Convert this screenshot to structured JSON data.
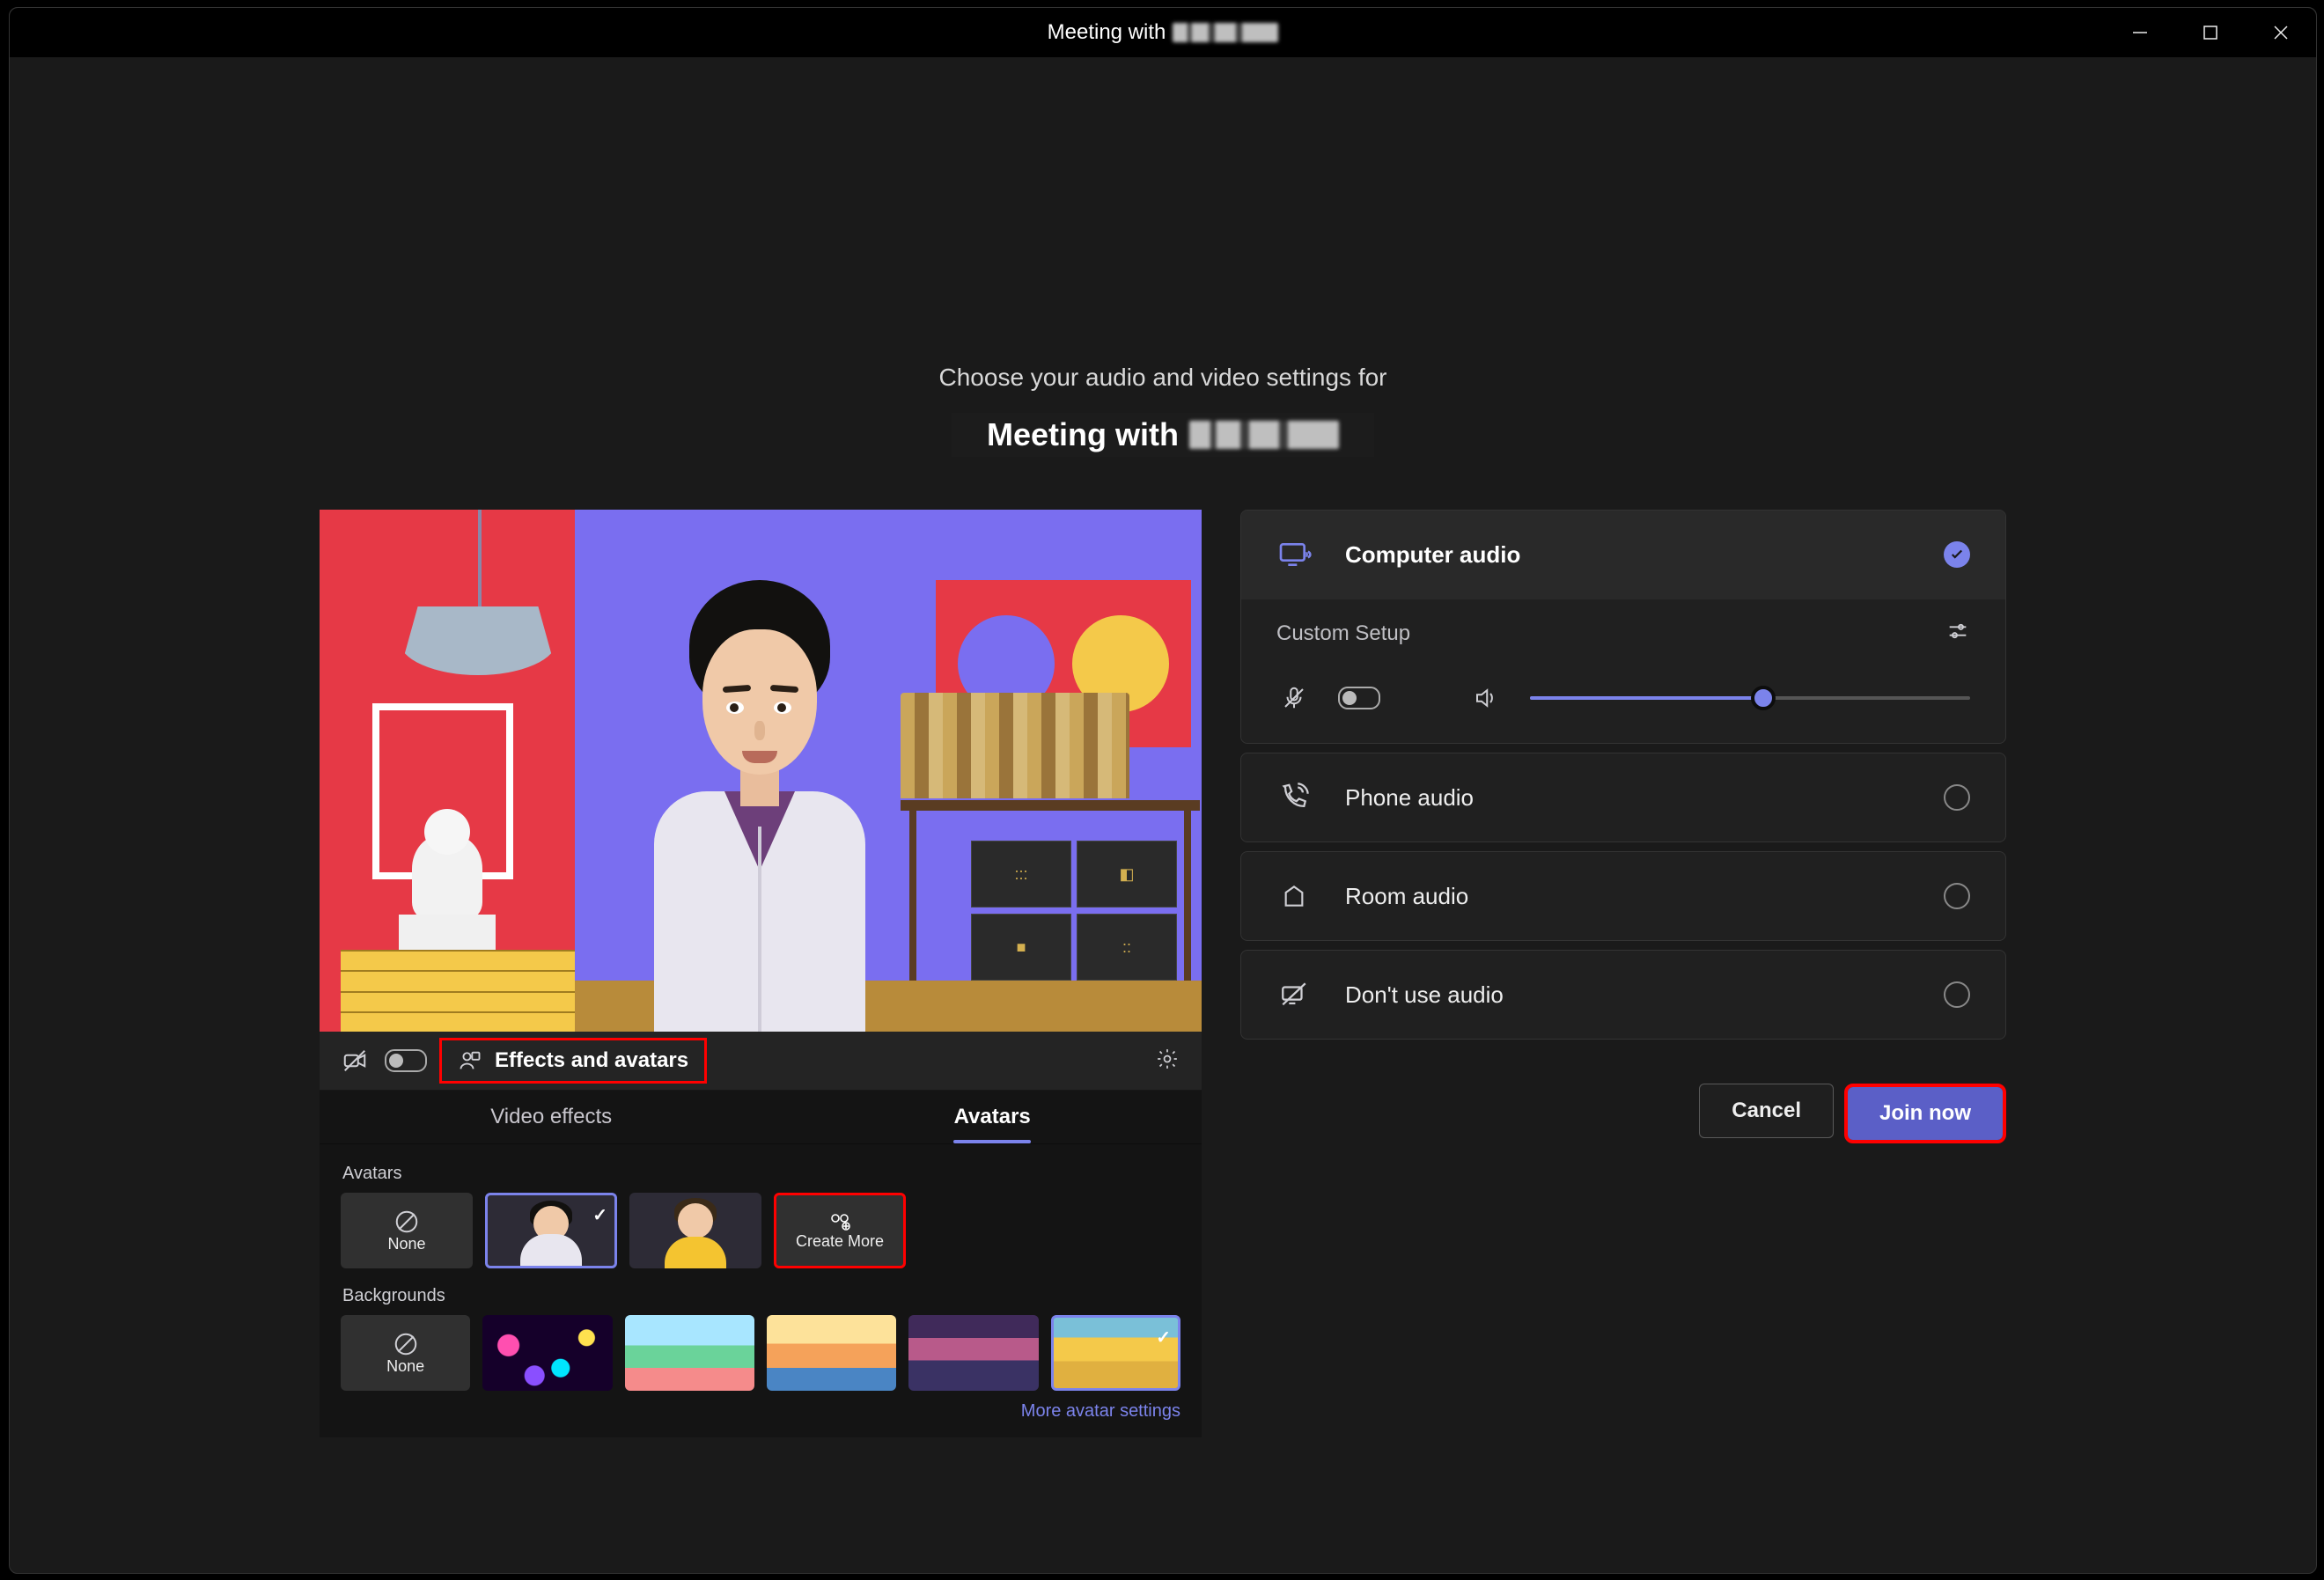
{
  "window": {
    "title_prefix": "Meeting with",
    "title_participant": "█████"
  },
  "header": {
    "prompt": "Choose your audio and video settings for",
    "meeting_prefix": "Meeting with",
    "meeting_participant": "█████"
  },
  "preview": {
    "camera_toggle_state": "off",
    "effects_button_label": "Effects and avatars",
    "settings_icon": "gear"
  },
  "tabs": {
    "video_effects": "Video effects",
    "avatars": "Avatars",
    "active": "avatars"
  },
  "avatars": {
    "section_label": "Avatars",
    "none_label": "None",
    "create_more_label": "Create More",
    "selected_index": 1
  },
  "backgrounds": {
    "section_label": "Backgrounds",
    "none_label": "None",
    "selected_index": 5,
    "more_settings": "More avatar settings"
  },
  "audio": {
    "computer_audio": "Computer audio",
    "custom_setup": "Custom Setup",
    "mic_state": "muted",
    "mic_toggle_state": "off",
    "volume_percent": 53,
    "phone_audio": "Phone audio",
    "room_audio": "Room audio",
    "no_audio": "Don't use audio",
    "selected": "computer_audio"
  },
  "actions": {
    "cancel": "Cancel",
    "join": "Join now"
  }
}
